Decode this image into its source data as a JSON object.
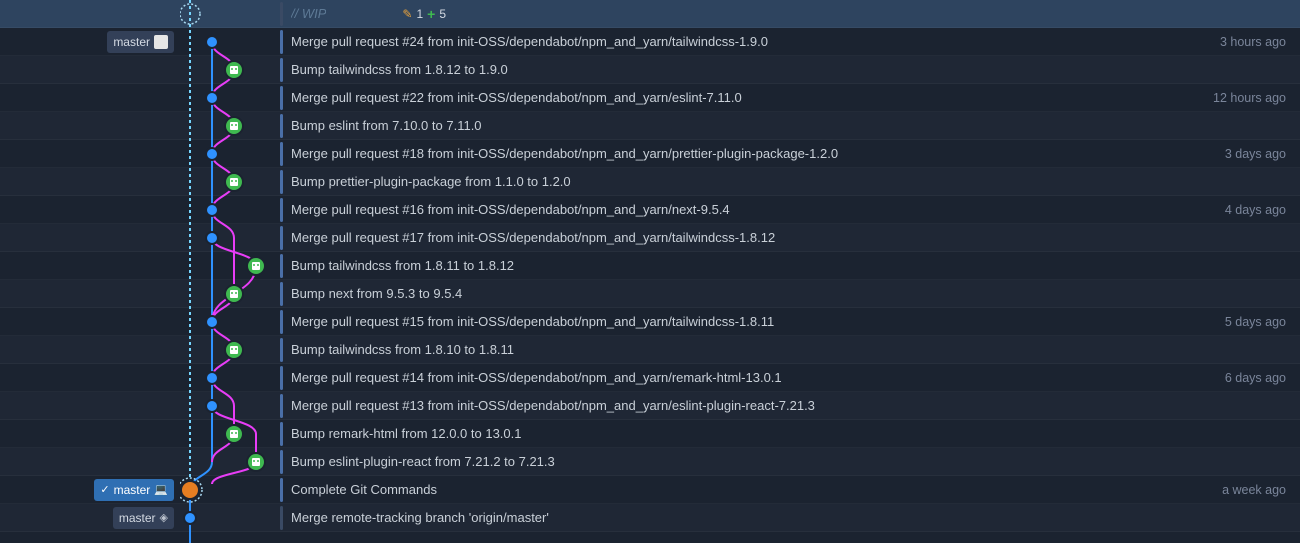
{
  "wip": {
    "text": "// WIP",
    "pen_icon": "✎",
    "changes": "1",
    "plus": "+",
    "additions": "5"
  },
  "labels": {
    "master_remote": "master",
    "master_local": "master",
    "master_origin": "master",
    "check": "✓",
    "laptop": "💻",
    "target": "◈"
  },
  "commits": [
    {
      "msg": "Merge pull request #24 from init-OSS/dependabot/npm_and_yarn/tailwindcss-1.9.0",
      "time": "3 hours ago",
      "node": {
        "x": 32,
        "color": "#2f92ff",
        "av": null
      },
      "showTime": true
    },
    {
      "msg": "Bump tailwindcss from 1.8.12 to 1.9.0",
      "time": "",
      "node": {
        "x": 54,
        "color": "#e83df7",
        "av": "bot"
      },
      "showTime": false
    },
    {
      "msg": "Merge pull request #22 from init-OSS/dependabot/npm_and_yarn/eslint-7.11.0",
      "time": "12 hours ago",
      "node": {
        "x": 32,
        "color": "#2f92ff",
        "av": null
      },
      "showTime": true
    },
    {
      "msg": "Bump eslint from 7.10.0 to 7.11.0",
      "time": "",
      "node": {
        "x": 54,
        "color": "#e83df7",
        "av": "bot"
      },
      "showTime": false
    },
    {
      "msg": "Merge pull request #18 from init-OSS/dependabot/npm_and_yarn/prettier-plugin-package-1.2.0",
      "time": "3 days ago",
      "node": {
        "x": 32,
        "color": "#2f92ff",
        "av": null
      },
      "showTime": true
    },
    {
      "msg": "Bump prettier-plugin-package from 1.1.0 to 1.2.0",
      "time": "",
      "node": {
        "x": 54,
        "color": "#e83df7",
        "av": "bot"
      },
      "showTime": false
    },
    {
      "msg": "Merge pull request #16 from init-OSS/dependabot/npm_and_yarn/next-9.5.4",
      "time": "4 days ago",
      "node": {
        "x": 32,
        "color": "#2f92ff",
        "av": null
      },
      "showTime": true
    },
    {
      "msg": "Merge pull request #17 from init-OSS/dependabot/npm_and_yarn/tailwindcss-1.8.12",
      "time": "",
      "node": {
        "x": 32,
        "color": "#2f92ff",
        "av": null
      },
      "showTime": false
    },
    {
      "msg": "Bump tailwindcss from 1.8.11 to 1.8.12",
      "time": "",
      "node": {
        "x": 76,
        "color": "#e83df7",
        "av": "bot"
      },
      "showTime": false
    },
    {
      "msg": "Bump next from 9.5.3 to 9.5.4",
      "time": "",
      "node": {
        "x": 54,
        "color": "#e83df7",
        "av": "bot"
      },
      "showTime": false
    },
    {
      "msg": "Merge pull request #15 from init-OSS/dependabot/npm_and_yarn/tailwindcss-1.8.11",
      "time": "5 days ago",
      "node": {
        "x": 32,
        "color": "#2f92ff",
        "av": null
      },
      "showTime": true
    },
    {
      "msg": "Bump tailwindcss from 1.8.10 to 1.8.11",
      "time": "",
      "node": {
        "x": 54,
        "color": "#e83df7",
        "av": "bot"
      },
      "showTime": false
    },
    {
      "msg": "Merge pull request #14 from init-OSS/dependabot/npm_and_yarn/remark-html-13.0.1",
      "time": "6 days ago",
      "node": {
        "x": 32,
        "color": "#2f92ff",
        "av": null
      },
      "showTime": true
    },
    {
      "msg": "Merge pull request #13 from init-OSS/dependabot/npm_and_yarn/eslint-plugin-react-7.21.3",
      "time": "",
      "node": {
        "x": 32,
        "color": "#2f92ff",
        "av": null
      },
      "showTime": false
    },
    {
      "msg": "Bump remark-html from 12.0.0 to 13.0.1",
      "time": "",
      "node": {
        "x": 54,
        "color": "#e83df7",
        "av": "bot"
      },
      "showTime": false
    },
    {
      "msg": "Bump eslint-plugin-react from 7.21.2 to 7.21.3",
      "time": "",
      "node": {
        "x": 76,
        "color": "#e83df7",
        "av": "bot"
      },
      "showTime": false
    },
    {
      "msg": "Complete Git Commands",
      "time": "a week ago",
      "node": {
        "x": 10,
        "color": "#2f92ff",
        "av": "usr",
        "ring": true
      },
      "showTime": true,
      "localHead": true
    },
    {
      "msg": "Merge remote-tracking branch 'origin/master'",
      "time": "",
      "node": {
        "x": 10,
        "color": "#2f92ff",
        "av": null
      },
      "showTime": false,
      "origin": true
    }
  ]
}
